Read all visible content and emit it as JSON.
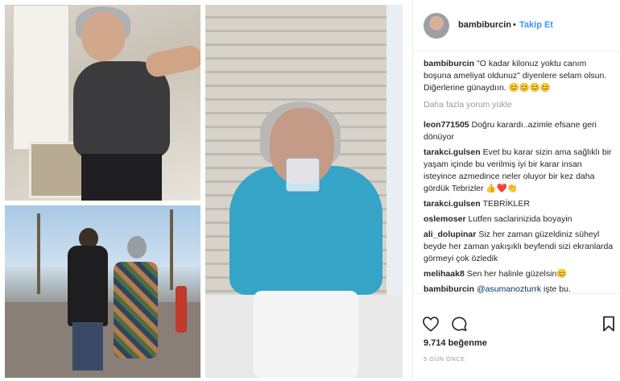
{
  "header": {
    "username": "bambiburcin",
    "separator": "•",
    "follow_label": "Takip Et"
  },
  "caption": {
    "username": "bambiburcin",
    "text": "\"O kadar kilonuz yoktu canım boşuna ameliyat oldunuz\" diyenlere selam olsun. Diğerlerine günaydıın. 😊😊😊😊"
  },
  "load_more_label": "Daha fazla yorum yükle",
  "comments": [
    {
      "username": "leon771505",
      "text": "Doğru karardı..azimle efsane geri dönüyor"
    },
    {
      "username": "tarakci.gulsen",
      "text": "Evet bu karar sizin ama sağlıklı bir yaşam içinde bu verilmiş iyi bir karar insan isteyince azmedince neler oluyor bir kez daha gördük Tebrizler 👍❤️👏"
    },
    {
      "username": "tarakci.gulsen",
      "text": "TEBRİKLER"
    },
    {
      "username": "oslemoser",
      "text": "Lutfen saclarinizida boyayin"
    },
    {
      "username": "ali_dolupinar",
      "text": "Siz her zaman güzeldiniz süheyl beyde her zaman yakışıklı beyfendi sizi ekranlarda görmeyi çok özledik"
    },
    {
      "username": "melihaak8",
      "text": "Sen her halinle güzelsin😊"
    },
    {
      "username": "bambiburcin",
      "mention": "@asumanozturrk",
      "text": " işte bu. Tecekkürler"
    }
  ],
  "likes": "9.714 beğenme",
  "time_ago": "5 GÜN ÖNCE",
  "icons": {
    "like": "heart-icon",
    "comment": "comment-icon",
    "save": "bookmark-icon"
  },
  "colors": {
    "link": "#3897f0",
    "text": "#262626",
    "muted": "#999999"
  }
}
